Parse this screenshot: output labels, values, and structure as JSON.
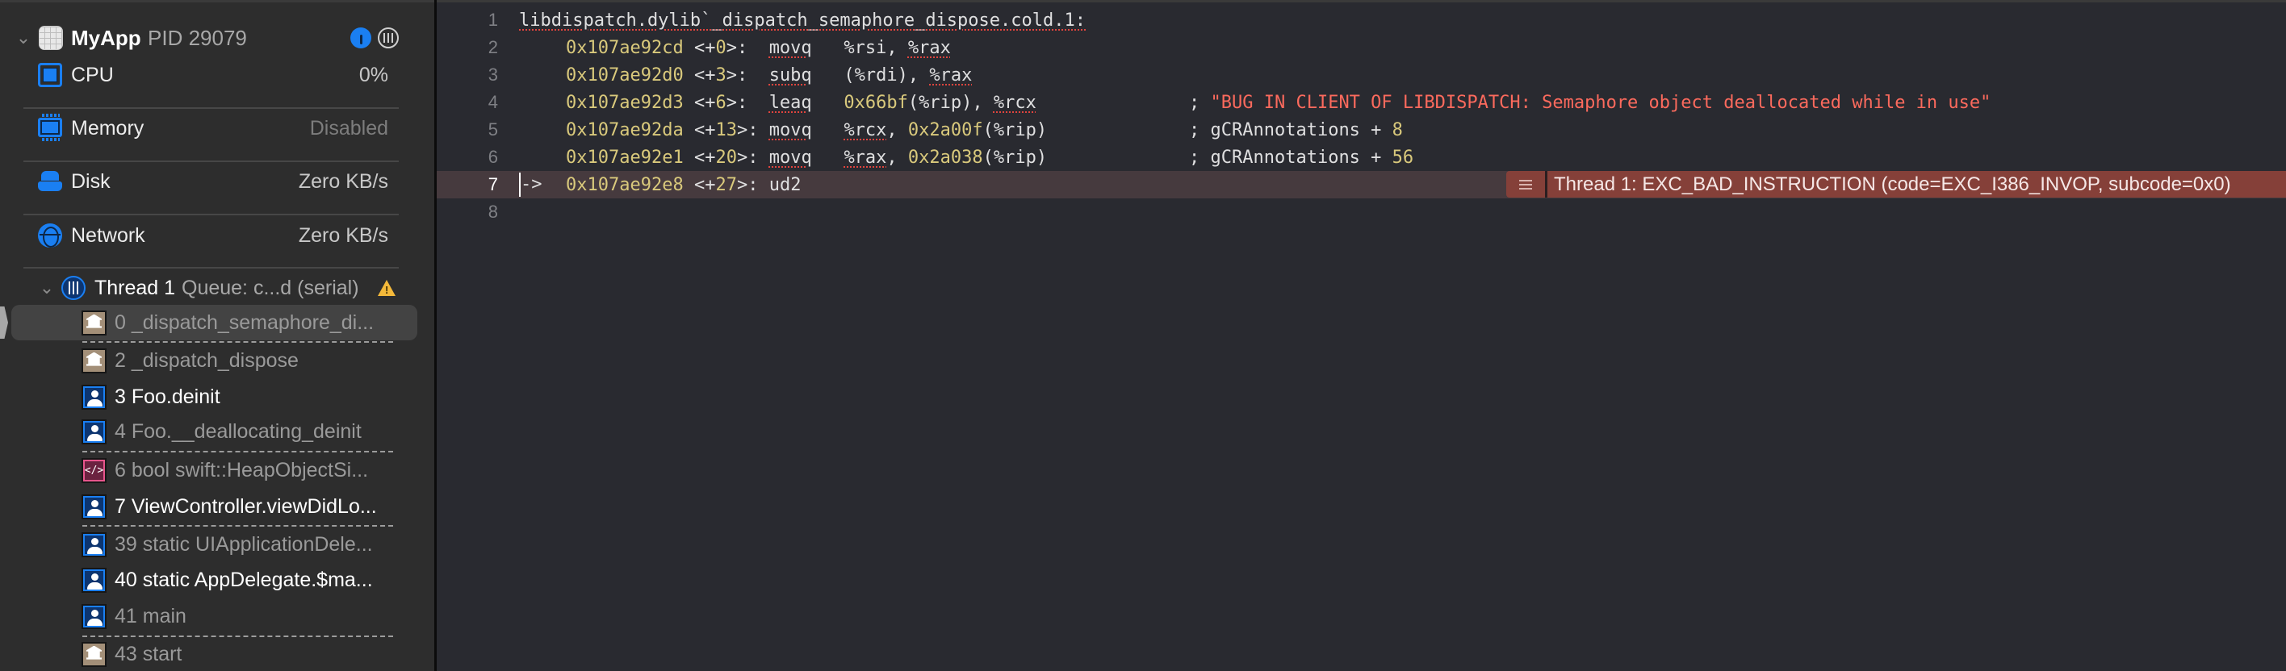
{
  "sidebar": {
    "process": {
      "name": "MyApp",
      "pid": "PID 29079",
      "icons": [
        "app-icon",
        "debug-gauge-icon",
        "threads-icon"
      ]
    },
    "gauges": [
      {
        "label": "CPU",
        "value": "0%",
        "icon": "cpu-icon"
      },
      {
        "label": "Memory",
        "value": "Disabled",
        "icon": "memory-icon"
      },
      {
        "label": "Disk",
        "value": "Zero KB/s",
        "icon": "disk-icon"
      },
      {
        "label": "Network",
        "value": "Zero KB/s",
        "icon": "network-icon"
      }
    ],
    "thread": {
      "name": "Thread 1",
      "queue": "Queue: c...d (serial)",
      "warning": "!"
    },
    "frames": [
      {
        "label": "0 _dispatch_semaphore_di...",
        "kind": "library",
        "selected": true
      },
      {
        "label": "2 _dispatch_dispose",
        "kind": "library"
      },
      {
        "label": "3 Foo.deinit",
        "kind": "user"
      },
      {
        "label": "4 Foo.__deallocating_deinit",
        "kind": "user"
      },
      {
        "label": "6 bool swift::HeapObjectSi...",
        "kind": "code"
      },
      {
        "label": "7 ViewController.viewDidLo...",
        "kind": "user"
      },
      {
        "label": "39 static UIApplicationDele...",
        "kind": "user"
      },
      {
        "label": "40 static AppDelegate.$ma...",
        "kind": "user"
      },
      {
        "label": "41 main",
        "kind": "user"
      },
      {
        "label": "43 start",
        "kind": "library"
      }
    ],
    "code_icon_glyph": "</>"
  },
  "editor": {
    "lines": [
      {
        "n": "1",
        "symbol": "libdispatch.dylib`_dispatch_semaphore_dispose.cold.1:"
      },
      {
        "n": "2",
        "addr": "0x107ae92cd",
        "off": "+0",
        "op": "movq",
        "args": [
          "%rsi",
          "%rax"
        ]
      },
      {
        "n": "3",
        "addr": "0x107ae92d0",
        "off": "+3",
        "op": "subq",
        "args": [
          "(%rdi)",
          "%rax"
        ]
      },
      {
        "n": "4",
        "addr": "0x107ae92d3",
        "off": "+6",
        "op": "leaq",
        "arg_num": "0x66bf",
        "arg_rest": "(%rip), ",
        "arg2": "%rcx",
        "comment": "\"BUG IN CLIENT OF LIBDISPATCH: Semaphore object deallocated while in use\""
      },
      {
        "n": "5",
        "addr": "0x107ae92da",
        "off": "+13",
        "op": "movq",
        "arg1": "%rcx",
        "arg_num": "0x2a00f",
        "arg_rest": "(%rip)",
        "comment_sym": "gCRAnnotations + ",
        "comment_num": "8"
      },
      {
        "n": "6",
        "addr": "0x107ae92e1",
        "off": "+20",
        "op": "movq",
        "arg1": "%rax",
        "arg_num": "0x2a038",
        "arg_rest": "(%rip)",
        "comment_sym": "gCRAnnotations + ",
        "comment_num": "56"
      },
      {
        "n": "7",
        "addr": "0x107ae92e8",
        "off": "+27",
        "op": "ud2",
        "current": true,
        "pc_arrow": "->"
      },
      {
        "n": "8"
      }
    ],
    "error": {
      "message": "Thread 1: EXC_BAD_INSTRUCTION (code=EXC_I386_INVOP, subcode=0x0)",
      "icon": "issue-menu-icon"
    }
  },
  "colors": {
    "accent_blue": "#1a7ff2",
    "number_yellow": "#d9c97c",
    "string_red": "#fc6a5d",
    "error_banner": "#854039",
    "current_line": "#463a3e",
    "warning": "#f4b93a"
  }
}
